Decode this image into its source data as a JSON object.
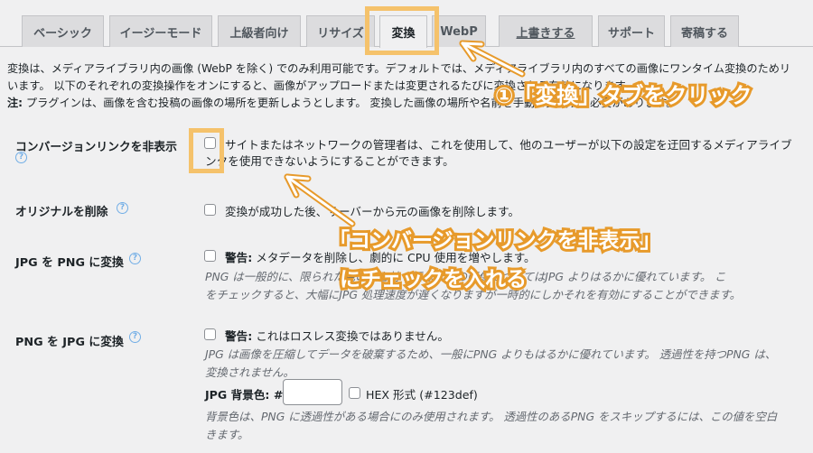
{
  "tabs": [
    {
      "label": "ベーシック"
    },
    {
      "label": "イージーモード"
    },
    {
      "label": "上級者向け"
    },
    {
      "label": "リサイズ"
    },
    {
      "label": "変換"
    },
    {
      "label": "WebP"
    },
    {
      "label": "上書きする"
    },
    {
      "label": "サポート"
    },
    {
      "label": "寄稿する"
    }
  ],
  "active_tab": "変換",
  "description": {
    "line1": "変換は、メディアライブラリ内の画像 (WebP を除く) でのみ利用可能です。デフォルトでは、メディアライブラリ内のすべての画像にワンタイム変換のためリ",
    "line2": "います。 以下のそれぞれの変換操作をオンにすると、画像がアップロードまたは変更されるたびに変換される有効になります。",
    "note_label": "注:",
    "line3": " プラグインは、画像を含む投稿の画像の場所を更新しようとします。 変換した画像の場所や名前を手動で変更する必要があります。"
  },
  "settings": {
    "hide_links": {
      "label": "コンバージョンリンクを非表示",
      "text1": "サイトまたはネットワークの管理者は、これを使用して、他のユーザーが以下の設定を迂回するメディアライブ",
      "text2": "ンクを使用できないようにすることができます。"
    },
    "delete_originals": {
      "label": "オリジナルを削除",
      "text": "変換が成功した後、サーバーから元の画像を削除します。"
    },
    "jpg_to_png": {
      "label": "JPG を PNG に変換",
      "warn_label": "警告:",
      "warn_text": " メタデータを削除し、劇的に CPU 使用を増やします。",
      "note1": "PNG は一般的に、限られた色の数を持つ画像などの画像についてはJPG よりはるかに優れています。 こ",
      "note2": "をチェックすると、大幅にJPG 処理速度が遅くなりますが一時的にしかそれを有効にすることができます。"
    },
    "png_to_jpg": {
      "label": "PNG を JPG に変換",
      "warn_label": "警告:",
      "warn_text": " これはロスレス変換ではありません。",
      "note1": "JPG は画像を圧縮してデータを破棄するため、一般にPNG よりもはるかに優れています。 透過性を持つPNG は、",
      "note2": "変換されません。",
      "bg_label": "JPG 背景色: #",
      "hex_label": "HEX 形式 (#123def)",
      "bg_note1": "背景色は、PNG に透過性がある場合にのみ使用されます。 透過性のあるPNG をスキップするには、この値を空白",
      "bg_note2": "きます。"
    }
  },
  "annotations": {
    "step1": "①「変換」タブをクリック",
    "step2_line1": "「コンバージョンリンクを非表示」",
    "step2_line2": "にチェックを入れる"
  },
  "colors": {
    "highlight": "#f5c26b",
    "callout_stroke": "#e79a2b",
    "help_icon": "#72aee6"
  }
}
